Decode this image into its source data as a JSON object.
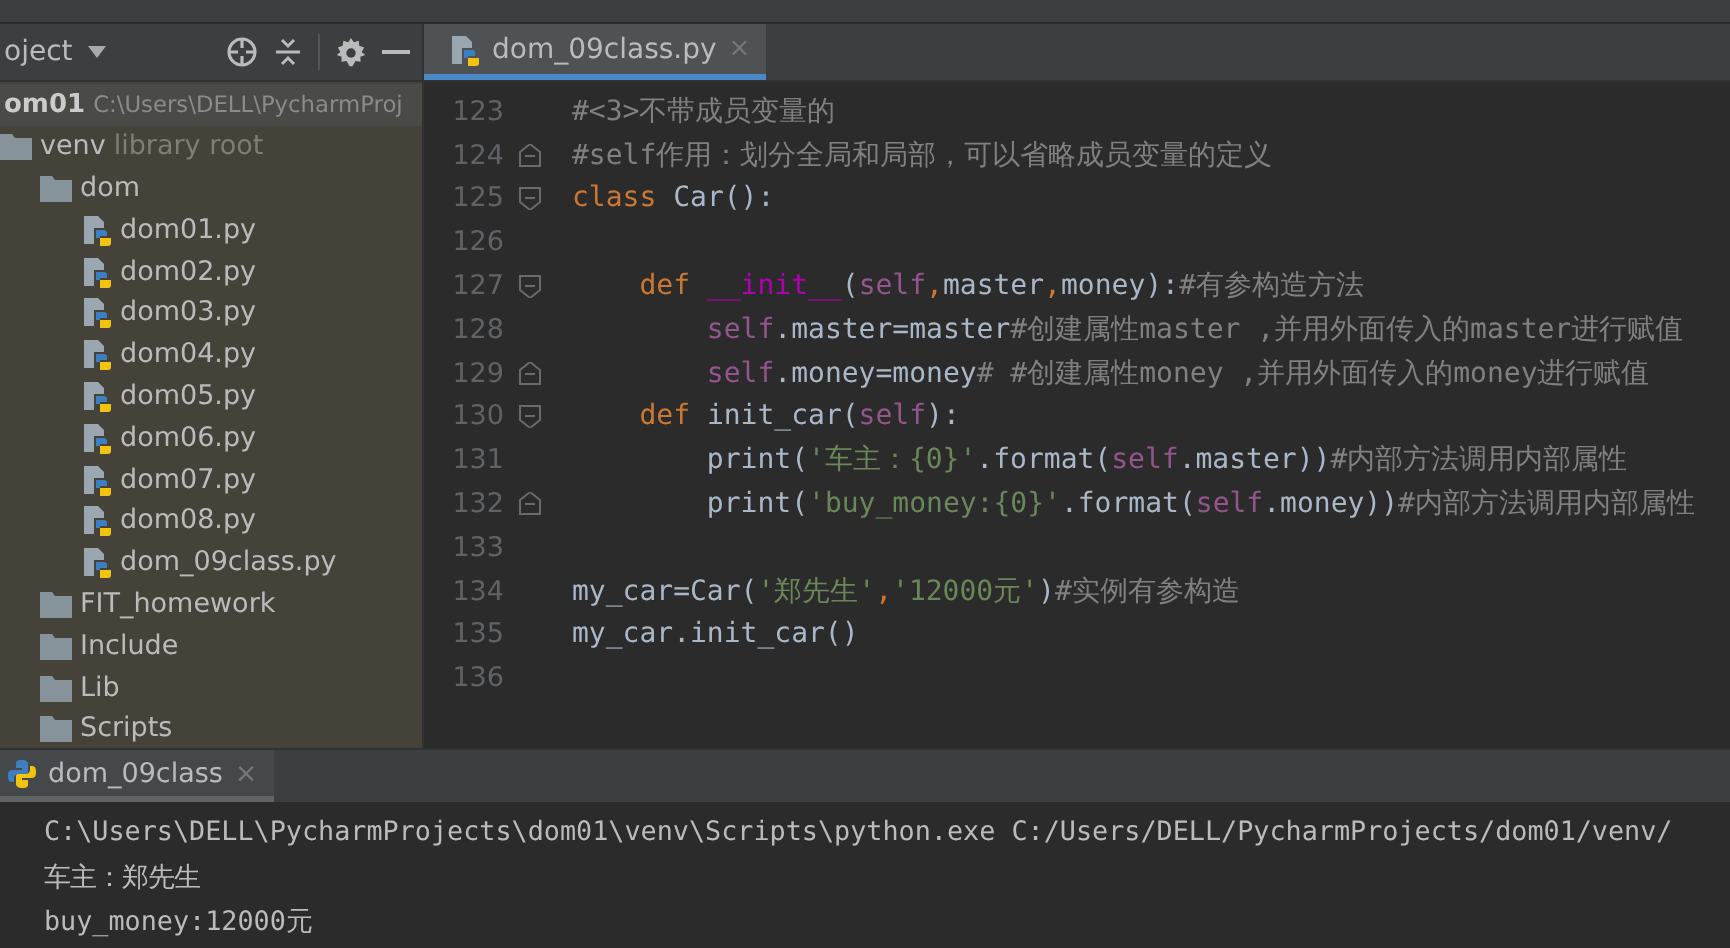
{
  "project_panel": {
    "title": "oject",
    "root": {
      "name": "om01",
      "path": "C:\\Users\\DELL\\PycharmProj",
      "children": [
        {
          "name": "venv",
          "kind": "folder",
          "note": "library root",
          "children": [
            {
              "name": "dom",
              "kind": "folder",
              "children": [
                {
                  "name": "dom01.py",
                  "kind": "python"
                },
                {
                  "name": "dom02.py",
                  "kind": "python"
                },
                {
                  "name": "dom03.py",
                  "kind": "python"
                },
                {
                  "name": "dom04.py",
                  "kind": "python"
                },
                {
                  "name": "dom05.py",
                  "kind": "python"
                },
                {
                  "name": "dom06.py",
                  "kind": "python"
                },
                {
                  "name": "dom07.py",
                  "kind": "python"
                },
                {
                  "name": "dom08.py",
                  "kind": "python"
                },
                {
                  "name": "dom_09class.py",
                  "kind": "python"
                }
              ]
            },
            {
              "name": "FIT_homework",
              "kind": "folder"
            },
            {
              "name": "Include",
              "kind": "folder"
            },
            {
              "name": "Lib",
              "kind": "folder"
            },
            {
              "name": "Scripts",
              "kind": "folder"
            }
          ]
        }
      ]
    }
  },
  "editor": {
    "tab": {
      "label": "dom_09class.py",
      "close_icon": "×",
      "selected": true
    },
    "lines": [
      {
        "number": "123",
        "tokens": [
          {
            "kind": "comment",
            "text": "#<3>不带成员变量的"
          }
        ]
      },
      {
        "number": "124",
        "fold_end": true,
        "tokens": [
          {
            "kind": "comment",
            "text": "#self作用：划分全局和局部，可以省略成员变量的定义"
          }
        ]
      },
      {
        "number": "125",
        "fold_start": true,
        "tokens": [
          {
            "kind": "keyword",
            "text": "class"
          },
          {
            "kind": "plain",
            "text": " Car():"
          }
        ]
      },
      {
        "number": "126"
      },
      {
        "number": "127",
        "fold_start": true,
        "tokens": [
          {
            "kind": "keyword",
            "text": "    def "
          },
          {
            "kind": "dunder",
            "text": "__init__"
          },
          {
            "kind": "plain",
            "text": "("
          },
          {
            "kind": "self",
            "text": "self"
          },
          {
            "kind": "keyword",
            "text": ","
          },
          {
            "kind": "plain",
            "text": "master"
          },
          {
            "kind": "keyword",
            "text": ","
          },
          {
            "kind": "plain",
            "text": "money):"
          },
          {
            "kind": "comment",
            "text": "#有参构造方法"
          }
        ]
      },
      {
        "number": "128",
        "tokens": [
          {
            "kind": "self",
            "text": "        self"
          },
          {
            "kind": "plain",
            "text": ".master=master"
          },
          {
            "kind": "comment",
            "text": "#创建属性master ,并用外面传入的master进行赋值"
          }
        ]
      },
      {
        "number": "129",
        "fold_end": true,
        "tokens": [
          {
            "kind": "self",
            "text": "        self"
          },
          {
            "kind": "plain",
            "text": ".money=money"
          },
          {
            "kind": "comment",
            "text": "# #创建属性money ,并用外面传入的money进行赋值"
          }
        ]
      },
      {
        "number": "130",
        "fold_start": true,
        "tokens": [
          {
            "kind": "keyword",
            "text": "    def "
          },
          {
            "kind": "plain",
            "text": "init_car("
          },
          {
            "kind": "self",
            "text": "self"
          },
          {
            "kind": "plain",
            "text": "):"
          }
        ]
      },
      {
        "number": "131",
        "tokens": [
          {
            "kind": "plain",
            "text": "        print("
          },
          {
            "kind": "string",
            "text": "'车主：{0}'"
          },
          {
            "kind": "plain",
            "text": ".format("
          },
          {
            "kind": "self",
            "text": "self"
          },
          {
            "kind": "plain",
            "text": ".master))"
          },
          {
            "kind": "comment",
            "text": "#内部方法调用内部属性"
          }
        ]
      },
      {
        "number": "132",
        "fold_end": true,
        "tokens": [
          {
            "kind": "plain",
            "text": "        print("
          },
          {
            "kind": "string",
            "text": "'buy_money:{0}'"
          },
          {
            "kind": "plain",
            "text": ".format("
          },
          {
            "kind": "self",
            "text": "self"
          },
          {
            "kind": "plain",
            "text": ".money))"
          },
          {
            "kind": "comment",
            "text": "#内部方法调用内部属性"
          }
        ]
      },
      {
        "number": "133"
      },
      {
        "number": "134",
        "tokens": [
          {
            "kind": "plain",
            "text": "my_car=Car("
          },
          {
            "kind": "string",
            "text": "'郑先生'"
          },
          {
            "kind": "keyword",
            "text": ","
          },
          {
            "kind": "string",
            "text": "'12000元'"
          },
          {
            "kind": "plain",
            "text": ")"
          },
          {
            "kind": "comment",
            "text": "#实例有参构造"
          }
        ]
      },
      {
        "number": "135",
        "tokens": [
          {
            "kind": "plain",
            "text": "my_car.init_car()"
          }
        ]
      },
      {
        "number": "136"
      }
    ]
  },
  "run_panel": {
    "tab": {
      "label": "dom_09class",
      "close_icon": "×",
      "selected": true
    },
    "output": [
      "C:\\Users\\DELL\\PycharmProjects\\dom01\\venv\\Scripts\\python.exe C:/Users/DELL/PycharmProjects/dom01/venv/",
      "车主：郑先生",
      "buy_money:12000元"
    ]
  }
}
